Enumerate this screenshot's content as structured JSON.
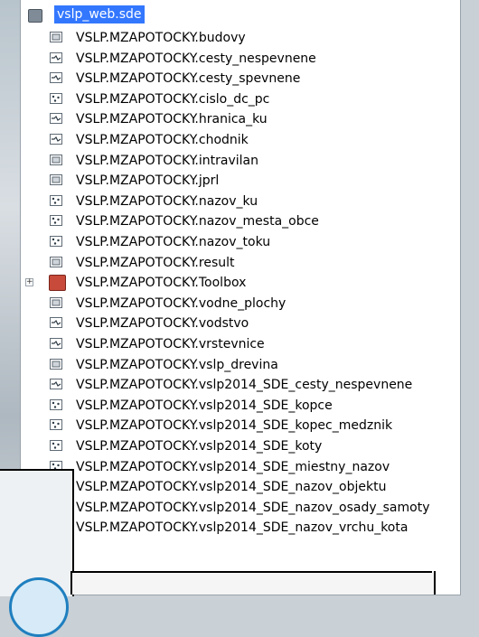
{
  "tree": {
    "root_label": "vslp_web.sde",
    "items": [
      {
        "label": "VSLP.MZAPOTOCKY.budovy",
        "type": "polygon"
      },
      {
        "label": "VSLP.MZAPOTOCKY.cesty_nespevnene",
        "type": "line"
      },
      {
        "label": "VSLP.MZAPOTOCKY.cesty_spevnene",
        "type": "line"
      },
      {
        "label": "VSLP.MZAPOTOCKY.cislo_dc_pc",
        "type": "point"
      },
      {
        "label": "VSLP.MZAPOTOCKY.hranica_ku",
        "type": "line"
      },
      {
        "label": "VSLP.MZAPOTOCKY.chodnik",
        "type": "line"
      },
      {
        "label": "VSLP.MZAPOTOCKY.intravilan",
        "type": "polygon"
      },
      {
        "label": "VSLP.MZAPOTOCKY.jprl",
        "type": "polygon"
      },
      {
        "label": "VSLP.MZAPOTOCKY.nazov_ku",
        "type": "point"
      },
      {
        "label": "VSLP.MZAPOTOCKY.nazov_mesta_obce",
        "type": "point"
      },
      {
        "label": "VSLP.MZAPOTOCKY.nazov_toku",
        "type": "point"
      },
      {
        "label": "VSLP.MZAPOTOCKY.result",
        "type": "polygon"
      },
      {
        "label": "VSLP.MZAPOTOCKY.Toolbox",
        "type": "toolbox",
        "expander": "+"
      },
      {
        "label": "VSLP.MZAPOTOCKY.vodne_plochy",
        "type": "polygon"
      },
      {
        "label": "VSLP.MZAPOTOCKY.vodstvo",
        "type": "line"
      },
      {
        "label": "VSLP.MZAPOTOCKY.vrstevnice",
        "type": "line"
      },
      {
        "label": "VSLP.MZAPOTOCKY.vslp_drevina",
        "type": "polygon"
      },
      {
        "label": "VSLP.MZAPOTOCKY.vslp2014_SDE_cesty_nespevnene",
        "type": "line"
      },
      {
        "label": "VSLP.MZAPOTOCKY.vslp2014_SDE_kopce",
        "type": "point"
      },
      {
        "label": "VSLP.MZAPOTOCKY.vslp2014_SDE_kopec_medznik",
        "type": "point"
      },
      {
        "label": "VSLP.MZAPOTOCKY.vslp2014_SDE_koty",
        "type": "point"
      },
      {
        "label": "VSLP.MZAPOTOCKY.vslp2014_SDE_miestny_nazov",
        "type": "point"
      },
      {
        "label": "VSLP.MZAPOTOCKY.vslp2014_SDE_nazov_objektu",
        "type": "point"
      },
      {
        "label": "VSLP.MZAPOTOCKY.vslp2014_SDE_nazov_osady_samoty",
        "type": "point"
      },
      {
        "label": "VSLP.MZAPOTOCKY.vslp2014_SDE_nazov_vrchu_kota",
        "type": "point"
      }
    ]
  },
  "colors": {
    "selection": "#3377ff",
    "toolbox": "#c84a3a"
  }
}
